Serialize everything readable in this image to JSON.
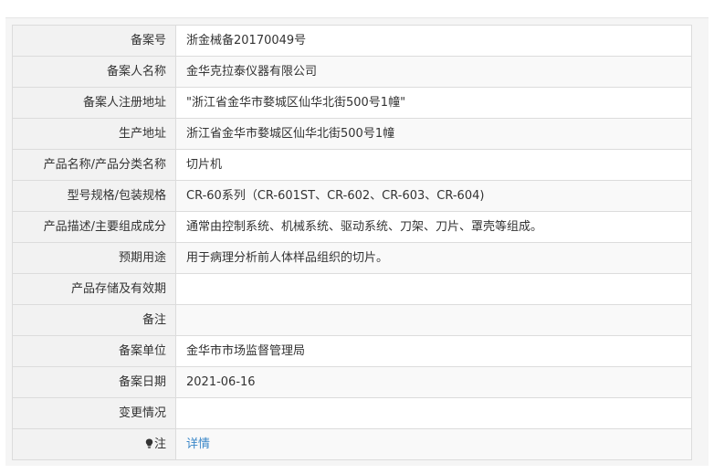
{
  "rows": [
    {
      "label": "备案号",
      "value": "浙金械备20170049号"
    },
    {
      "label": "备案人名称",
      "value": "金华克拉泰仪器有限公司"
    },
    {
      "label": "备案人注册地址",
      "value": "\"浙江省金华市婺城区仙华北街500号1幢\""
    },
    {
      "label": "生产地址",
      "value": "浙江省金华市婺城区仙华北街500号1幢"
    },
    {
      "label": "产品名称/产品分类名称",
      "value": "切片机"
    },
    {
      "label": "型号规格/包装规格",
      "value": "CR-60系列（CR-601ST、CR-602、CR-603、CR-604)"
    },
    {
      "label": "产品描述/主要组成成分",
      "value": "通常由控制系统、机械系统、驱动系统、刀架、刀片、罩壳等组成。"
    },
    {
      "label": "预期用途",
      "value": "用于病理分析前人体样品组织的切片。"
    },
    {
      "label": "产品存储及有效期",
      "value": ""
    },
    {
      "label": "备注",
      "value": ""
    },
    {
      "label": "备案单位",
      "value": "金华市市场监督管理局"
    },
    {
      "label": "备案日期",
      "value": "2021-06-16"
    },
    {
      "label": "变更情况",
      "value": ""
    }
  ],
  "note": {
    "icon": "lightbulb-icon",
    "label": "注",
    "link_text": "详情",
    "link_color": "#3a87c8"
  }
}
